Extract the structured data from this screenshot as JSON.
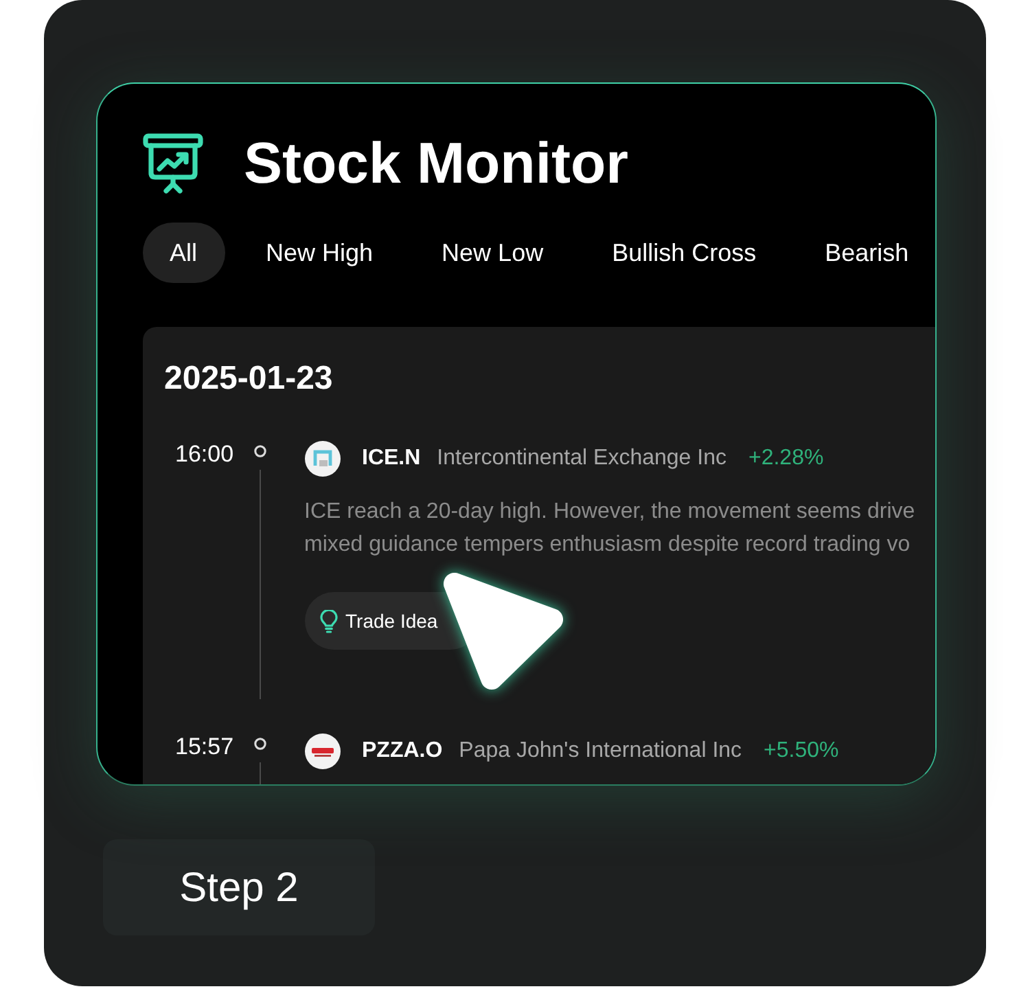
{
  "app": {
    "title": "Stock Monitor"
  },
  "tabs": [
    {
      "label": "All",
      "selected": true
    },
    {
      "label": "New High",
      "selected": false
    },
    {
      "label": "New Low",
      "selected": false
    },
    {
      "label": "Bullish Cross",
      "selected": false
    },
    {
      "label": "Bearish",
      "selected": false
    }
  ],
  "feed": {
    "date": "2025-01-23",
    "events": [
      {
        "time": "16:00",
        "symbol": "ICE.N",
        "company": "Intercontinental Exchange Inc",
        "change": "+2.28%",
        "gain": true,
        "description_lines": [
          "ICE reach a 20-day high. However, the movement seems drive",
          "mixed guidance tempers enthusiasm despite record trading vo"
        ],
        "action": "Trade Idea"
      },
      {
        "time": "15:57",
        "symbol": "PZZA.O",
        "company": "Papa John's International Inc",
        "change": "+5.50%",
        "gain": true
      }
    ]
  },
  "step_label": "Step 2"
}
